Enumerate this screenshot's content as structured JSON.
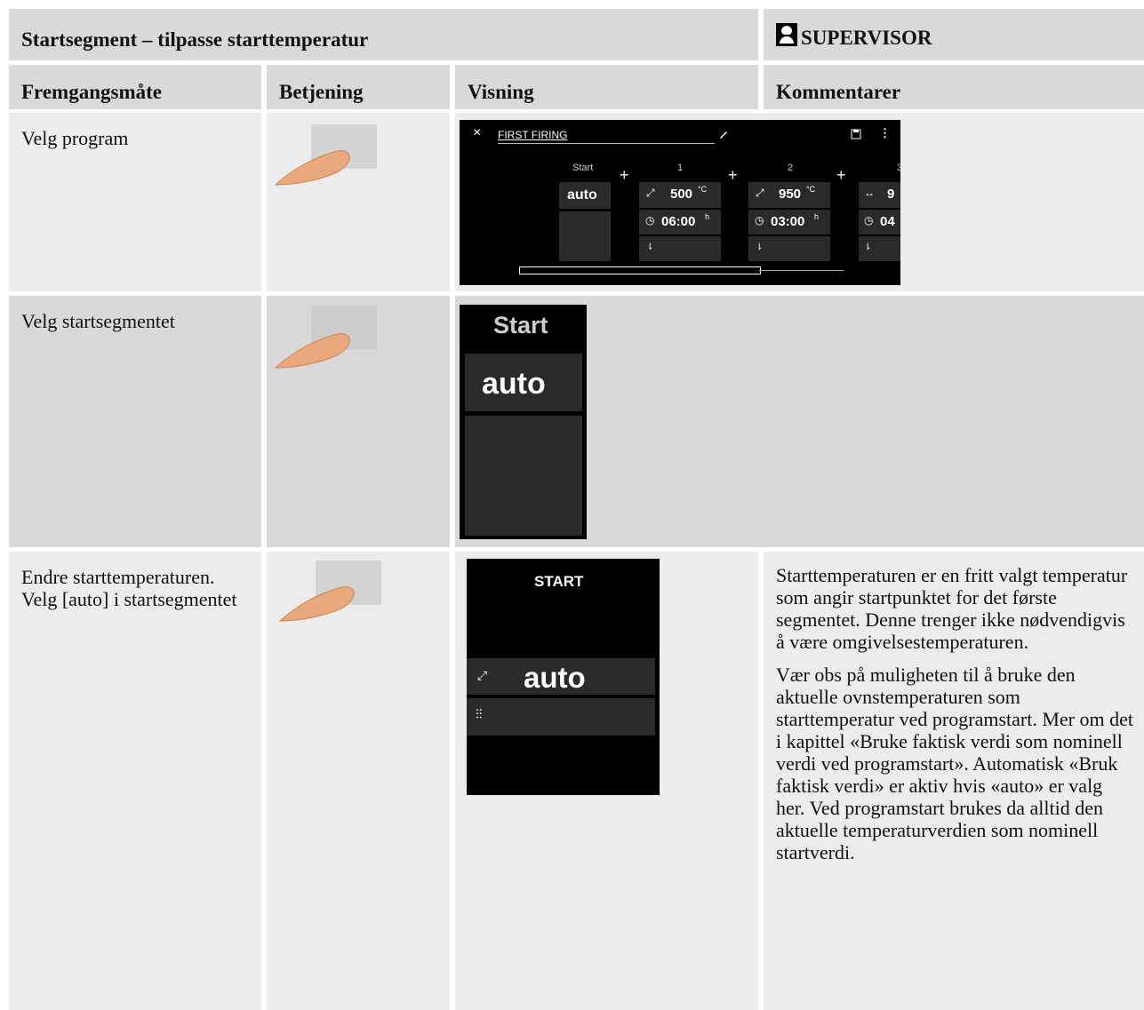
{
  "title": "Startsegment – tilpasse starttemperatur",
  "role": "SUPERVISOR",
  "columns": [
    "Fremgangsmåte",
    "Betjening",
    "Visning",
    "Kommentarer"
  ],
  "rows": [
    {
      "step": "Velg program"
    },
    {
      "step": "Velg startsegmentet"
    },
    {
      "step": "Endre starttemperaturen. Velg [auto] i startsegmentet"
    }
  ],
  "screen1": {
    "close_icon": "×",
    "program_name": "FIRST FIRING",
    "start_label": "Start",
    "start_value": "auto",
    "segments": [
      {
        "num": "1",
        "temp": "500",
        "temp_unit": "°C",
        "time": "06:00",
        "time_unit": "h"
      },
      {
        "num": "2",
        "temp": "950",
        "temp_unit": "°C",
        "time": "03:00",
        "time_unit": "h"
      },
      {
        "num": "3",
        "temp": "9",
        "temp_unit": "",
        "time": "04",
        "time_unit": ""
      }
    ],
    "plus": "+"
  },
  "screen2": {
    "label": "Start",
    "value": "auto"
  },
  "screen3": {
    "label": "START",
    "value": "auto"
  },
  "comment": {
    "p1": "Starttemperaturen er en fritt valgt temperatur som angir startpunktet for det første segmentet. Denne trenger ikke nødvendigvis å være omgivelsestemperaturen.",
    "p2": "Vær obs på muligheten til å bruke den aktuelle ovnstemperaturen som starttemperatur ved programstart. Mer om det i kapittel «Bruke faktisk verdi som nominell verdi ved programstart». Automatisk «Bruk faktisk verdi» er aktiv hvis «auto» er valg her. Ved programstart brukes da alltid den aktuelle temperaturverdien som nominell startverdi."
  }
}
